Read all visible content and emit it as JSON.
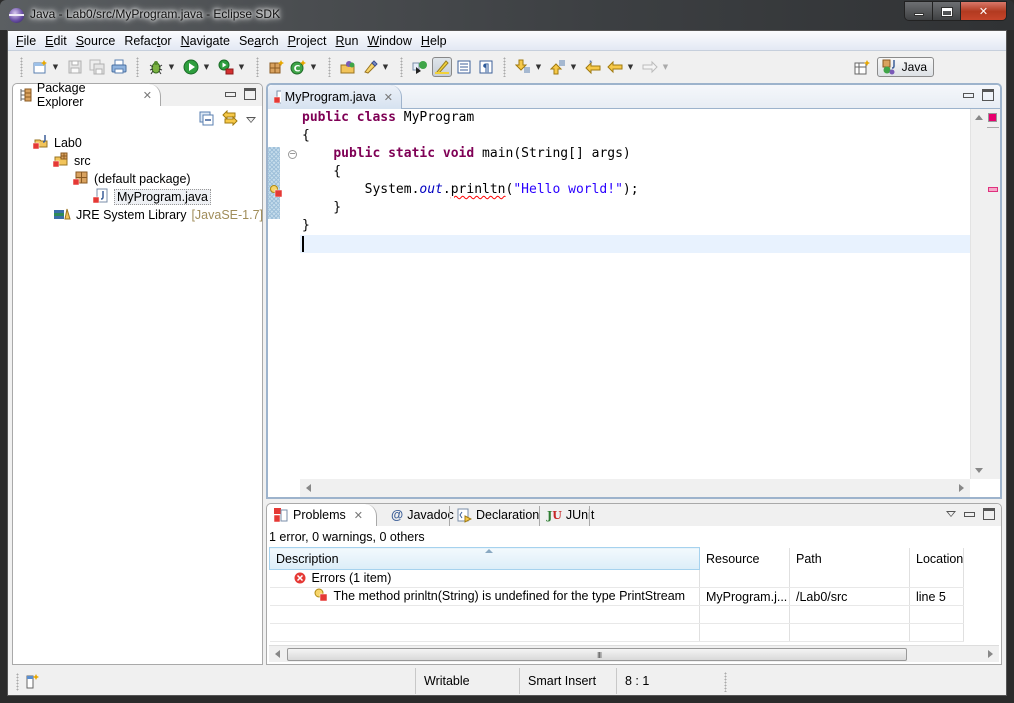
{
  "window": {
    "title": "Java - Lab0/src/MyProgram.java - Eclipse SDK",
    "controls": [
      "minimize",
      "maximize",
      "close"
    ]
  },
  "menubar": {
    "items": [
      {
        "label": "File",
        "mnemonic": "F"
      },
      {
        "label": "Edit",
        "mnemonic": "E"
      },
      {
        "label": "Source",
        "mnemonic": "S"
      },
      {
        "label": "Refactor",
        "mnemonic": "t"
      },
      {
        "label": "Navigate",
        "mnemonic": "N"
      },
      {
        "label": "Search",
        "mnemonic": "a"
      },
      {
        "label": "Project",
        "mnemonic": "P"
      },
      {
        "label": "Run",
        "mnemonic": "R"
      },
      {
        "label": "Window",
        "mnemonic": "W"
      },
      {
        "label": "Help",
        "mnemonic": "H"
      }
    ]
  },
  "toolbar": {
    "groups": [
      [
        "new-icon",
        "save-icon",
        "save-all-icon",
        "print-icon"
      ],
      [
        "debug-icon",
        "run-icon",
        "external-tools-icon"
      ],
      [
        "new-java-package-icon",
        "new-java-class-icon"
      ],
      [
        "open-type-icon",
        "open-task-icon"
      ],
      [
        "toggle-breadcrumb-icon",
        "mark-occurrences-icon",
        "block-selection-icon",
        "show-whitespace-icon"
      ],
      [
        "next-annotation-icon",
        "previous-annotation-icon",
        "last-edit-location-icon",
        "back-icon",
        "forward-icon"
      ]
    ],
    "perspective": {
      "label": "Java",
      "active": true
    }
  },
  "package_explorer": {
    "title": "Package Explorer",
    "tree": [
      {
        "label": "Lab0",
        "icon": "java-project-icon",
        "depth": 0,
        "error": true
      },
      {
        "label": "src",
        "icon": "source-folder-icon",
        "depth": 1,
        "error": true
      },
      {
        "label": "(default package)",
        "icon": "package-icon",
        "depth": 2,
        "error": true
      },
      {
        "label": "MyProgram.java",
        "icon": "java-file-icon",
        "depth": 3,
        "error": true,
        "selected": true
      },
      {
        "label": "JRE System Library",
        "decoration": "[JavaSE-1.7]",
        "icon": "library-icon",
        "depth": 1,
        "error": false
      }
    ]
  },
  "editor": {
    "tab_label": "MyProgram.java",
    "code_lines": [
      "public class MyProgram",
      "{",
      "    public static void main(String[] args)",
      "    {",
      "        System.out.prinltn(\"Hello world!\");",
      "    }",
      "}",
      ""
    ],
    "cursor": {
      "line": 8,
      "column": 1
    }
  },
  "problems_view": {
    "tabs": [
      {
        "label": "Problems",
        "icon": "problems-icon",
        "active": true
      },
      {
        "label": "Javadoc",
        "icon": "javadoc-icon",
        "active": false
      },
      {
        "label": "Declaration",
        "icon": "declaration-icon",
        "active": false
      },
      {
        "label": "JUnit",
        "icon": "junit-icon",
        "active": false
      }
    ],
    "summary": "1 error, 0 warnings, 0 others",
    "columns": [
      "Description",
      "Resource",
      "Path",
      "Location"
    ],
    "rows": [
      {
        "description": "Errors (1 item)",
        "resource": "",
        "path": "",
        "location": "",
        "type": "group"
      },
      {
        "description": "The method prinltn(String) is undefined for the type PrintStream",
        "resource": "MyProgram.j...",
        "path": "/Lab0/src",
        "location": "line 5",
        "type": "error"
      }
    ]
  },
  "statusbar": {
    "writable": "Writable",
    "insert_mode": "Smart Insert",
    "position": "8 : 1"
  },
  "colors": {
    "keyword": "#7f0055",
    "string": "#2a00ff",
    "field": "#0000c0",
    "current_line": "#e8f2fe",
    "error_marker": "#e8006e"
  }
}
